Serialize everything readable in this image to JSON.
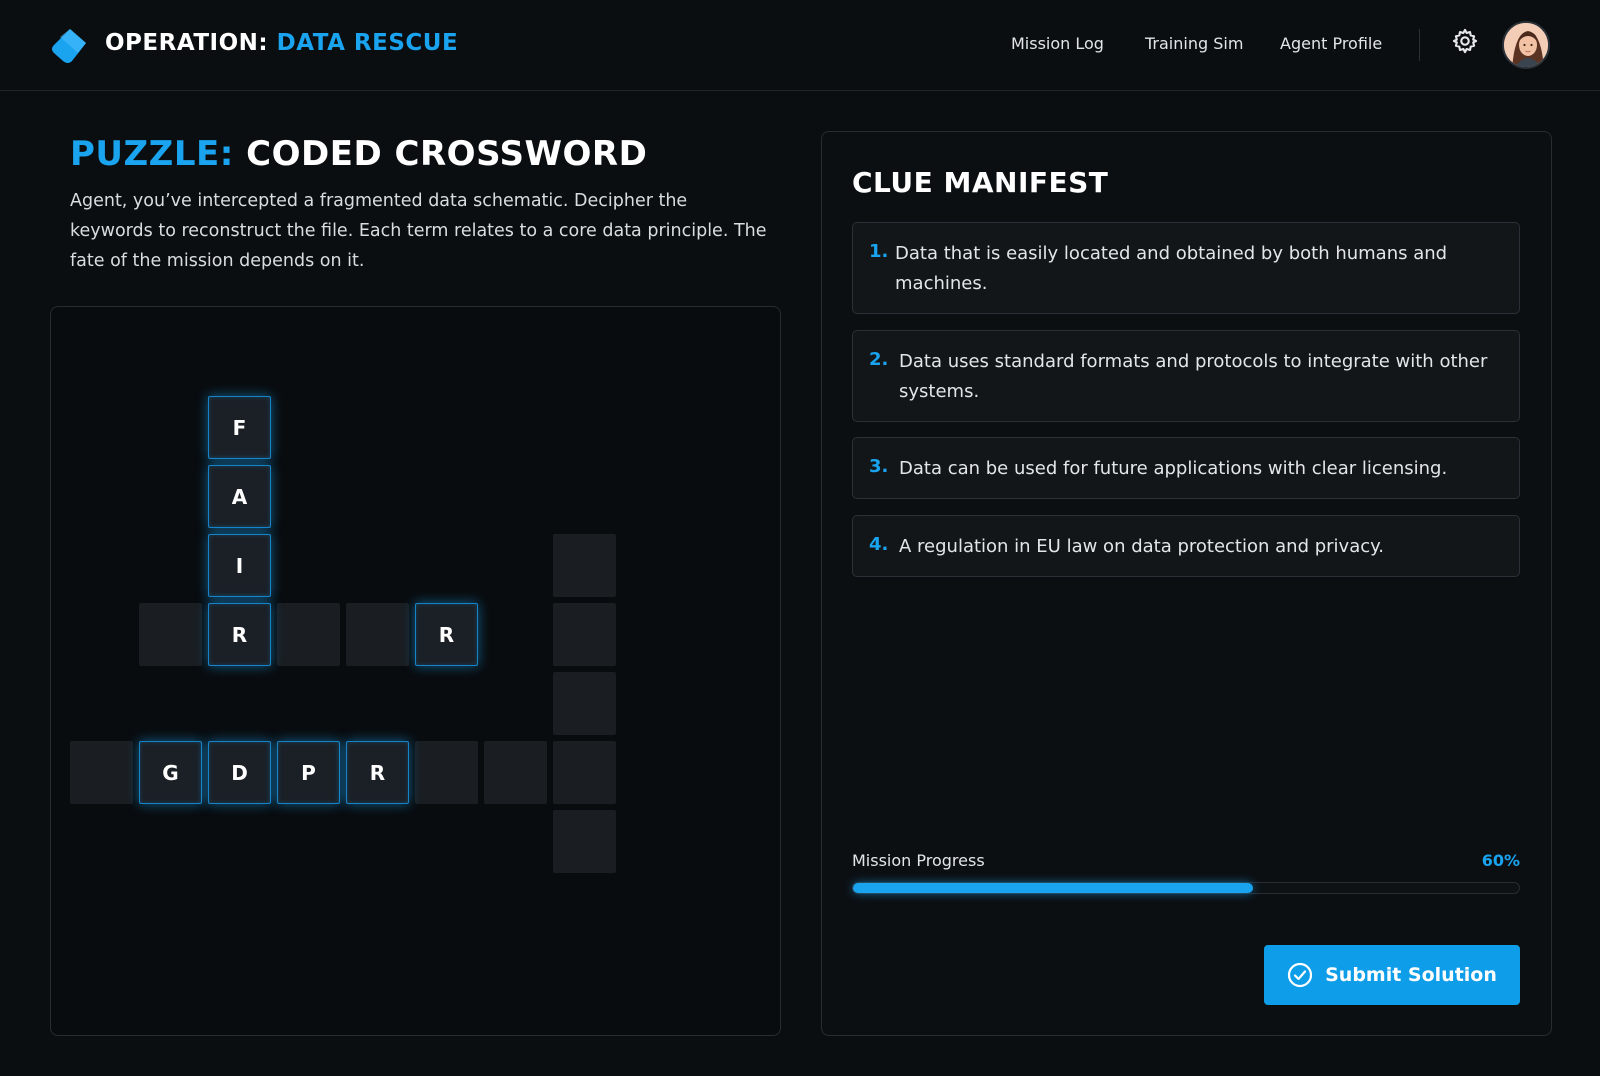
{
  "header": {
    "brand_prefix": "OPERATION:",
    "brand_accent": "DATA RESCUE",
    "nav": [
      {
        "label": "Mission Log"
      },
      {
        "label": "Training Sim"
      },
      {
        "label": "Agent Profile"
      }
    ],
    "icons": [
      "data-shard-logo-icon",
      "gear-icon",
      "avatar"
    ]
  },
  "puzzle": {
    "title_prefix": "PUZZLE:",
    "title": "CODED CROSSWORD",
    "intro": "Agent, you’ve intercepted a fragmented data schematic. Decipher the keywords to reconstruct the file. Each term relates to a core data principle. The fate of the mission depends on it.",
    "grid": {
      "rows": [
        [
          "",
          "",
          "",
          "",
          "",
          "",
          "",
          "",
          ""
        ],
        [
          "",
          "",
          "F",
          "",
          "",
          "",
          "",
          "",
          ""
        ],
        [
          "",
          "",
          "A",
          "",
          "",
          "",
          "",
          "",
          ""
        ],
        [
          "",
          "",
          "I",
          "",
          "",
          "",
          "",
          "",
          ""
        ],
        [
          "",
          "",
          "R",
          "",
          "",
          "R",
          "",
          "",
          ""
        ],
        [
          "",
          "",
          "",
          "",
          "",
          "",
          "",
          "",
          ""
        ],
        [
          "",
          "G",
          "D",
          "P",
          "R",
          "",
          "",
          "",
          ""
        ],
        [
          "",
          "",
          "",
          "",
          "",
          "",
          "",
          "",
          ""
        ]
      ],
      "filled_cells": [
        {
          "row": 1,
          "col": 2,
          "letter": "F"
        },
        {
          "row": 2,
          "col": 2,
          "letter": "A"
        },
        {
          "row": 3,
          "col": 2,
          "letter": "I"
        },
        {
          "row": 4,
          "col": 2,
          "letter": "R"
        },
        {
          "row": 4,
          "col": 5,
          "letter": "R"
        },
        {
          "row": 6,
          "col": 1,
          "letter": "G"
        },
        {
          "row": 6,
          "col": 2,
          "letter": "D"
        },
        {
          "row": 6,
          "col": 3,
          "letter": "P"
        },
        {
          "row": 6,
          "col": 4,
          "letter": "R"
        }
      ],
      "empty_cells": [
        {
          "row": 4,
          "col": 1
        },
        {
          "row": 4,
          "col": 3
        },
        {
          "row": 4,
          "col": 4
        },
        {
          "row": 3,
          "col": 7
        },
        {
          "row": 4,
          "col": 7
        },
        {
          "row": 5,
          "col": 7
        },
        {
          "row": 6,
          "col": 0
        },
        {
          "row": 6,
          "col": 5
        },
        {
          "row": 6,
          "col": 6
        },
        {
          "row": 6,
          "col": 7
        },
        {
          "row": 7,
          "col": 7
        }
      ]
    }
  },
  "clues": {
    "title": "CLUE MANIFEST",
    "items": [
      {
        "num": "1.",
        "text": "Data that is easily located and obtained by both humans and machines."
      },
      {
        "num": "2.",
        "text": "Data uses standard formats and protocols to integrate with other systems."
      },
      {
        "num": "3.",
        "text": "Data can be used for future applications with clear licensing."
      },
      {
        "num": "4.",
        "text": "A regulation in EU law on data protection and privacy."
      }
    ]
  },
  "progress": {
    "label": "Mission Progress",
    "value_text": "60%",
    "fraction": 0.6
  },
  "submit": {
    "label": "Submit Solution",
    "icon": "check-circle-icon"
  },
  "colors": {
    "accent": "#1aa3ef",
    "background": "#0b0e11",
    "panel_border": "#262c32",
    "cell_empty": "#1a1e22"
  }
}
